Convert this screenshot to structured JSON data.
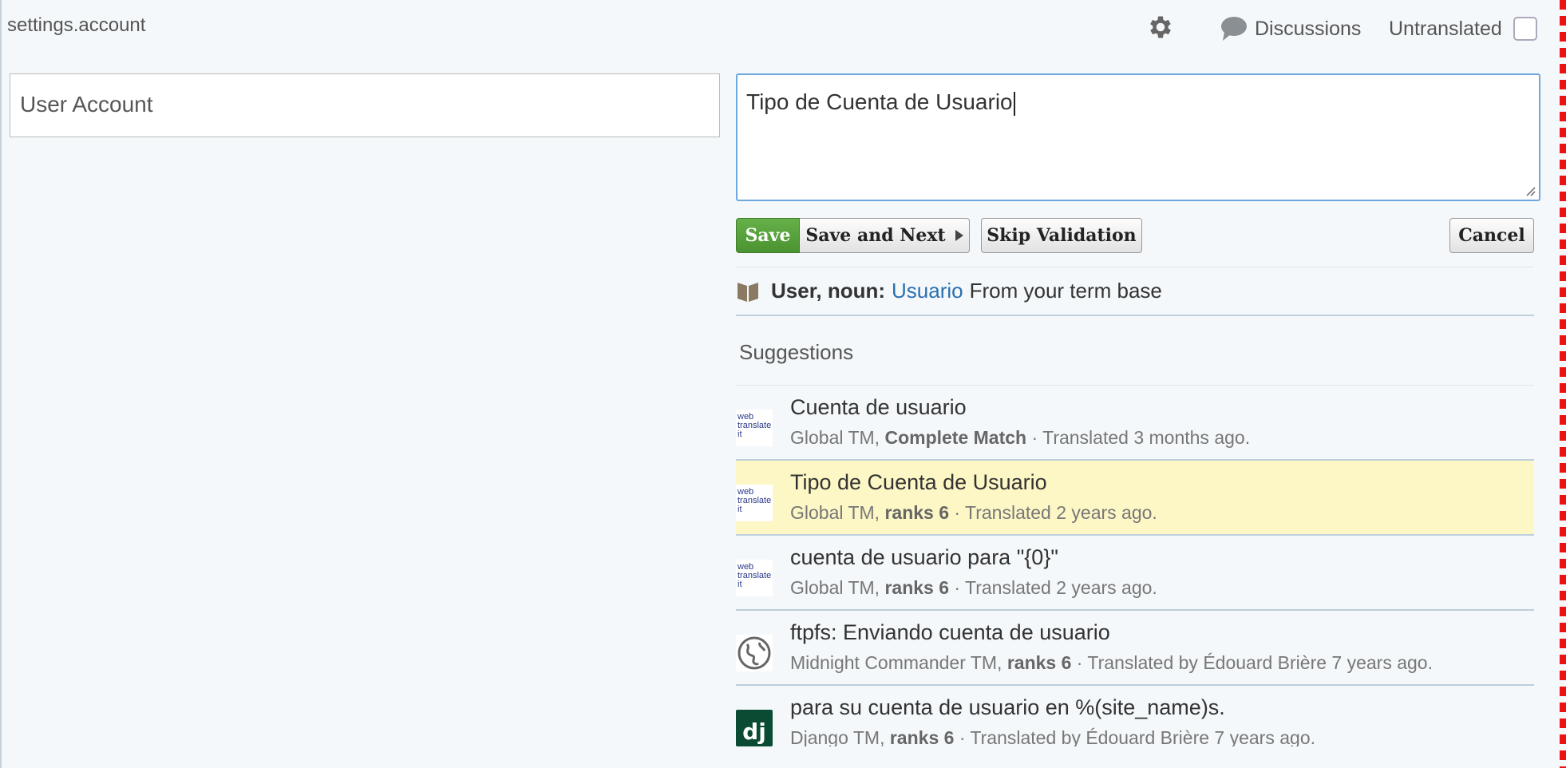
{
  "header": {
    "key": "settings.account",
    "discussions_label": "Discussions",
    "untranslated_label": "Untranslated"
  },
  "editor": {
    "source_text": "User Account",
    "target_text": "Tipo de Cuenta de Usuario"
  },
  "buttons": {
    "save": "Save",
    "save_next": "Save and Next",
    "skip_validation": "Skip Validation",
    "cancel": "Cancel"
  },
  "term": {
    "label": "User, noun:",
    "translation": "Usuario",
    "source": "From your term base"
  },
  "suggestions": {
    "title": "Suggestions",
    "items": [
      {
        "text": "Cuenta de usuario",
        "tm": "Global TM,",
        "rank": "Complete Match",
        "detail": "· Translated 3 months ago.",
        "logo": "webtranslate-logo",
        "highlighted": false
      },
      {
        "text": "Tipo de Cuenta de Usuario",
        "tm": "Global TM,",
        "rank": "ranks 6",
        "detail": "· Translated 2 years ago.",
        "logo": "webtranslate-logo",
        "highlighted": true
      },
      {
        "text": "cuenta de usuario para \"{0}\"",
        "tm": "Global TM,",
        "rank": "ranks 6",
        "detail": "· Translated 2 years ago.",
        "logo": "webtranslate-logo",
        "highlighted": false
      },
      {
        "text": "ftpfs: Enviando cuenta de usuario",
        "tm": "Midnight Commander TM,",
        "rank": "ranks 6",
        "detail": "· Translated by Édouard Brière 7 years ago.",
        "logo": "globe-icon",
        "highlighted": false
      },
      {
        "text": "para su cuenta de usuario en %(site_name)s.",
        "tm": "Django TM,",
        "rank": "ranks 6",
        "detail": "· Translated by Édouard Brière 7 years ago.",
        "logo": "django-logo",
        "highlighted": false
      }
    ]
  },
  "logo_text": {
    "webtranslate": [
      "web",
      "translate",
      "it"
    ],
    "django": "dj"
  },
  "colors": {
    "save_green": "#5aa23c",
    "highlight": "#fdf7c6",
    "link": "#2a6fb0",
    "focus_border": "#6fa8dc"
  }
}
